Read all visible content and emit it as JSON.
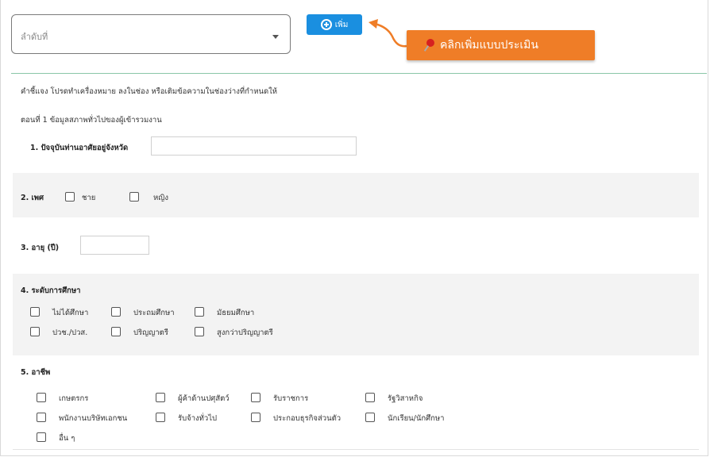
{
  "select": {
    "placeholder": "ลำดับที่"
  },
  "add_button": {
    "label": "เพิ่ม"
  },
  "callout": {
    "text": "คลิกเพิ่มแบบประเมิน"
  },
  "form": {
    "instruction": "คำชี้แจง โปรดทำเครื่องหมาย ลงในช่อง หรือเติมข้อความในช่องว่างที่กำหนดให้",
    "part1_title": "ตอนที่ 1 ข้อมูลสภาพทั่วไปของผู้เข้ารวมงาน",
    "q1": {
      "label": "1. ปัจจุบันท่านอาศัยอยู่จังหวัด"
    },
    "q2": {
      "label": "2. เพศ",
      "options": [
        "ชาย",
        "หญิง"
      ]
    },
    "q3": {
      "label": "3. อายุ (ปี)"
    },
    "q4": {
      "label": "4. ระดับการศึกษา",
      "options": [
        "ไม่ได้ศึกษา",
        "ประถมศึกษา",
        "มัธยมศึกษา",
        "ปวช./ปวส.",
        "ปริญญาตรี",
        "สูงกว่าปริญญาตรี"
      ]
    },
    "q5": {
      "label": "5. อาชีพ",
      "options": [
        "เกษตรกร",
        "ผู้ค้าด้านปศุสัตว์",
        "รับราชการ",
        "รัฐวิสาหกิจ",
        "พนักงานบริษัทเอกชน",
        "รับจ้างทั่วไป",
        "ประกอบธุรกิจส่วนตัว",
        "นักเรียน/นักศึกษา",
        "อื่น ๆ"
      ]
    }
  },
  "colors": {
    "button_blue": "#1a8fe0",
    "callout_orange": "#ef7d27",
    "divider_green": "#8ac6a8"
  }
}
